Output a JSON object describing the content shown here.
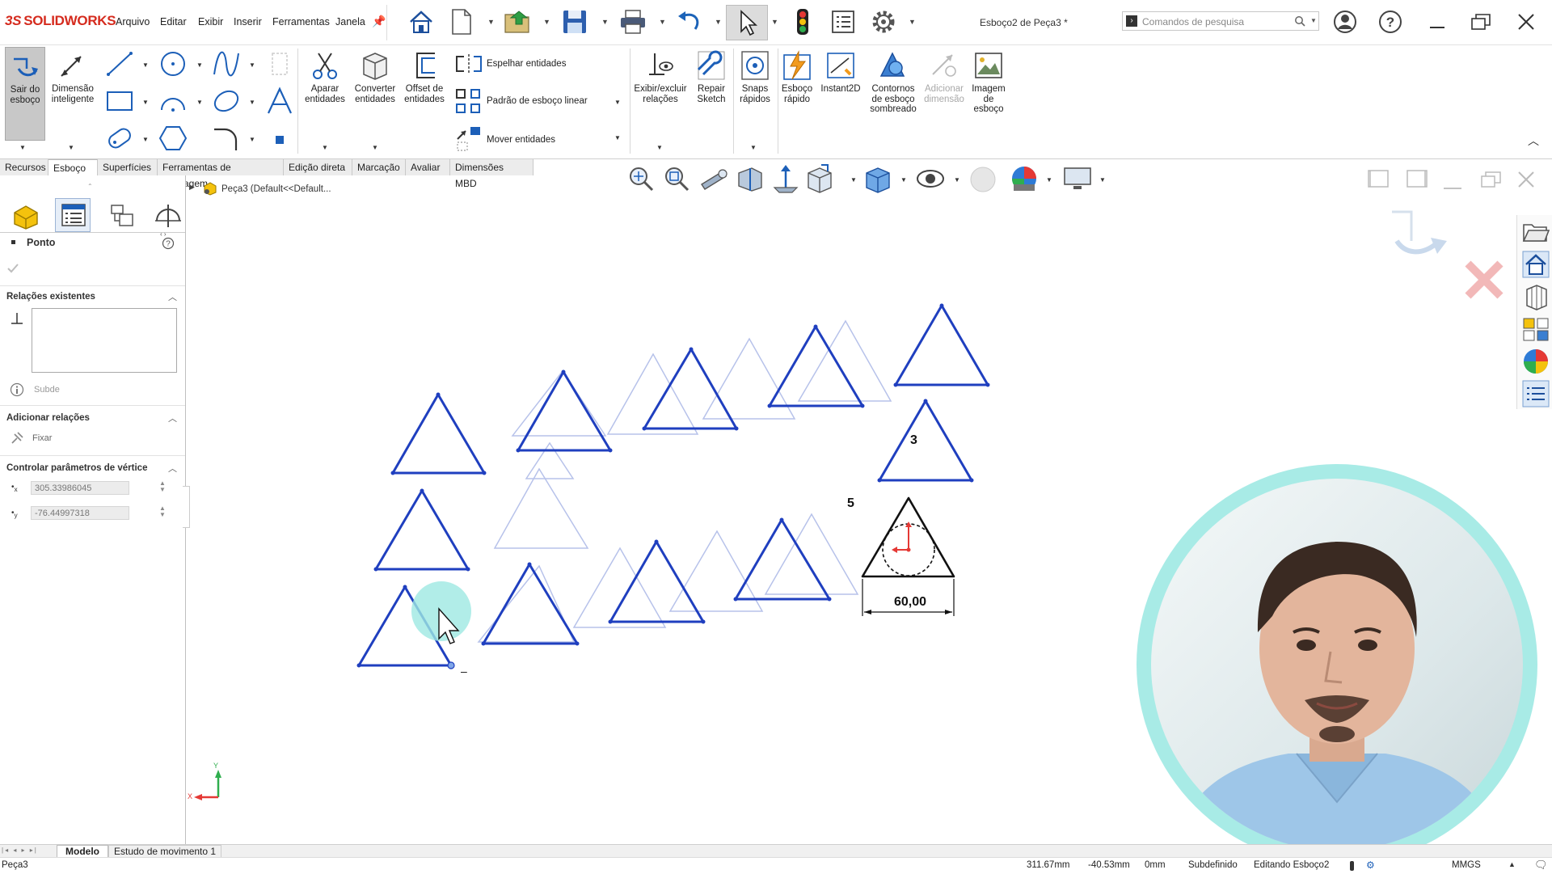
{
  "app": {
    "brand_prefix": "3S",
    "brand": "SOLIDWORKS"
  },
  "menu": [
    "Arquivo",
    "Editar",
    "Exibir",
    "Inserir",
    "Ferramentas",
    "Janela"
  ],
  "document_title": "Esboço2 de Peça3 *",
  "search": {
    "placeholder": "Comandos de pesquisa"
  },
  "ribbon": {
    "exit_sketch": "Sair do esboço",
    "smart_dimension": "Dimensão inteligente",
    "trim": "Aparar entidades",
    "convert": "Converter entidades",
    "offset": "Offset de entidades",
    "mirror": "Espelhar entidades",
    "linear_pattern": "Padrão de esboço linear",
    "move": "Mover entidades",
    "show_relations": "Exibir/excluir relações",
    "repair": "Repair Sketch",
    "quick_snaps": "Snaps rápidos",
    "rapid_sketch": "Esboço rápido",
    "instant2d": "Instant2D",
    "shaded_contours": "Contornos de esboço sombreado",
    "add_dimension": "Adicionar dimensão",
    "sketch_image": "Imagem de esboço"
  },
  "tabs": [
    "Recursos",
    "Esboço",
    "Superfícies",
    "Ferramentas de moldagem",
    "Edição direta",
    "Marcação",
    "Avaliar",
    "Dimensões MBD"
  ],
  "active_tab": "Esboço",
  "tree": {
    "label": "Peça3  (Default<<Default..."
  },
  "property_manager": {
    "title": "Ponto",
    "existing_relations": "Relações existentes",
    "status": "Subde",
    "add_relations": "Adicionar relações",
    "fix": "Fixar",
    "vertex_params": "Controlar parâmetros de vértice",
    "x_value": "305.33986045",
    "y_value": "-76.44997318"
  },
  "canvas": {
    "dimension": "60,00",
    "label_3": "3",
    "label_5": "5",
    "minus": "–",
    "axis_x": "X",
    "axis_y": "Y"
  },
  "bottom_tabs": [
    "Modelo",
    "Estudo de movimento 1"
  ],
  "status": {
    "part": "Peça3",
    "x": "311.67mm",
    "y": "-40.53mm",
    "z": "0mm",
    "state": "Subdefinido",
    "editing": "Editando Esboço2",
    "units": "MMGS"
  },
  "colors": {
    "accent": "#1f3fbf",
    "brand": "#d52b1e",
    "highlight": "#9ee9e2"
  }
}
